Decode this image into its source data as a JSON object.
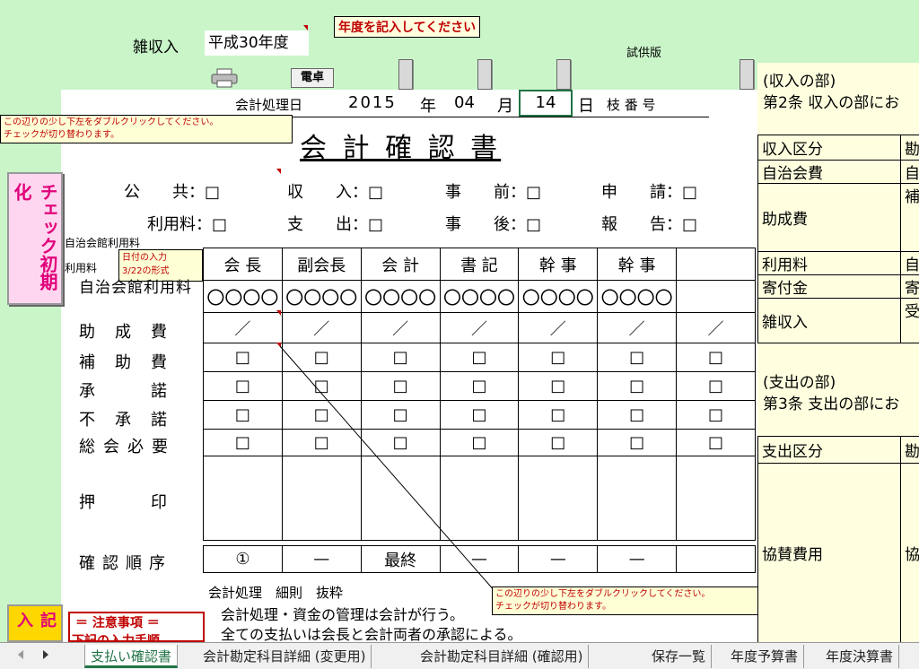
{
  "header": {
    "misc_income_label": "雑収入",
    "year_value": "平成30年度",
    "year_note": "年度を記入してください",
    "trial_label": "試供版",
    "calc_button": "電卓"
  },
  "date_row": {
    "label": "会計処理日",
    "year": "2015",
    "year_unit": "年",
    "month": "04",
    "month_unit": "月",
    "day": "14",
    "day_unit": "日",
    "branch_label": "枝 番 号"
  },
  "notes": {
    "top_left_line1": "この辺りの少し下左をダブルクリックしてください。",
    "top_left_line2": "チェックが切り替わります。",
    "bottom_line1": "この辺りの少し下左をダブルクリックしてください。",
    "bottom_line2": "チェックが切り替わります。",
    "date_hint_line1": "日付の入力",
    "date_hint_line2": "3/22の形式"
  },
  "title": "会 計 確 認 書",
  "reset_button": "チェック初期化",
  "checks": {
    "public": "公　　共",
    "income": "収　　入",
    "before": "事　　前",
    "apply": "申　　請",
    "fee": "利用料",
    "expense": "支　　出",
    "after": "事　　後",
    "report": "報　　告",
    "mark": "：□"
  },
  "side_labels": {
    "hall_fee": "自治会館利用料",
    "fee": "利用料"
  },
  "columns": [
    "会 長",
    "副会長",
    "会 計",
    "書 記",
    "幹 事",
    "幹 事",
    ""
  ],
  "rows": {
    "hall_label": "自治会館利用料",
    "hall_values": [
      "〇〇〇〇",
      "〇〇〇〇",
      "〇〇〇〇",
      "〇〇〇〇",
      "〇〇〇〇",
      "〇〇〇〇",
      ""
    ],
    "subsidy_label": "助　成　費",
    "subsidy_values": [
      "／",
      "／",
      "／",
      "／",
      "／",
      "／",
      "／"
    ],
    "aid_label": "補　助　費",
    "approve_label": "承　　　諾",
    "disapprove_label": "不　承　諾",
    "assembly_label": "総会必要",
    "seal_label": "押　　　印",
    "order_label": "確認順序",
    "order_values": [
      "①",
      "—",
      "最終",
      "—",
      "—",
      "—",
      ""
    ],
    "checkbox": "□"
  },
  "footer_text": {
    "title": "会計処理　細則　抜粋",
    "line1": "会計処理・資金の管理は会計が行う。",
    "line2": "全ての支払いは会長と会計両者の承認による。"
  },
  "left_bottom": {
    "entry_button": "記入",
    "notice_line1": "＝ 注意事項 ＝",
    "notice_line2": "下記の入力手順"
  },
  "right_panel": {
    "income_section": "(収入の部)",
    "income_article": "第2条 収入の部にお",
    "income_table": [
      [
        "収入区分",
        "勘"
      ],
      [
        "自治会費",
        "自"
      ],
      [
        "助成費",
        "補"
      ],
      [
        "利用料",
        "自"
      ],
      [
        "寄付金",
        "寄"
      ],
      [
        "雑収入",
        "受"
      ]
    ],
    "expense_section": "(支出の部)",
    "expense_article": "第3条 支出の部にお",
    "expense_table": [
      [
        "支出区分",
        "勘"
      ],
      [
        "協賛費用",
        "協"
      ]
    ]
  },
  "sheet_tabs": [
    "支払い確認書",
    "会計勘定科目詳細 (変更用)",
    "会計勘定科目詳細 (確認用)",
    "保存一覧",
    "年度予算書",
    "年度決算書"
  ]
}
